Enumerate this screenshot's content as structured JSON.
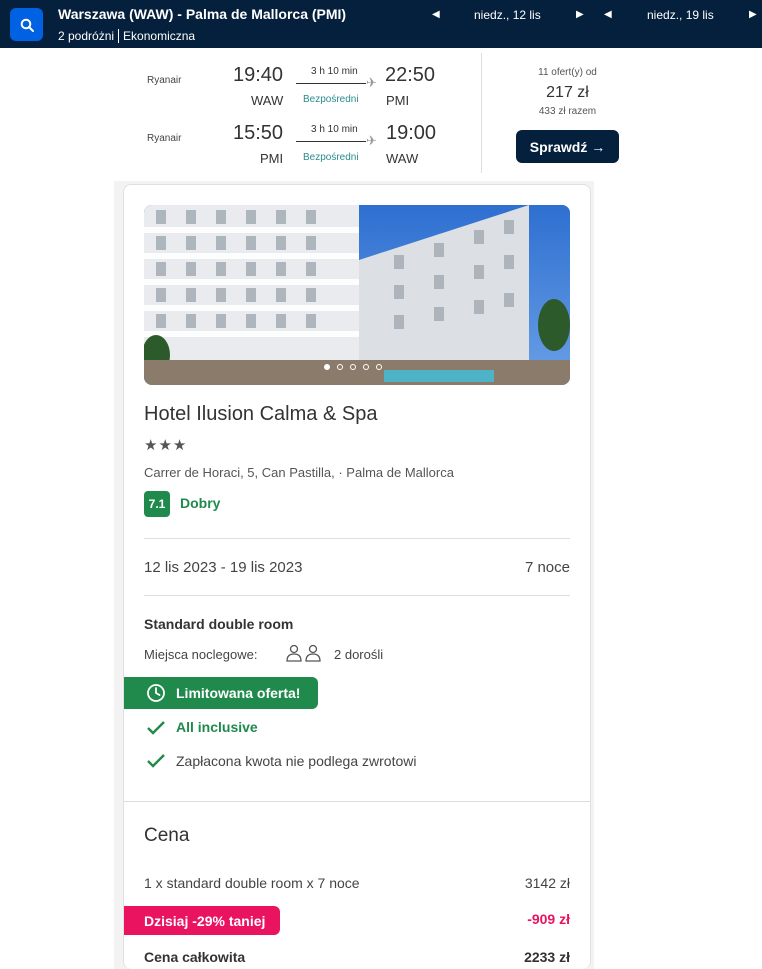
{
  "header": {
    "route": "Warszawa (WAW) - Palma de Mallorca (PMI)",
    "travellers": "2 podróżni",
    "cabin": "Ekonomiczna",
    "depart_date": "niedz., 12 lis",
    "return_date": "niedz., 19 lis"
  },
  "flights": {
    "outbound": {
      "airline": "Ryanair",
      "dep_time": "19:40",
      "dep_code": "WAW",
      "duration": "3 h 10 min",
      "stops": "Bezpośredni",
      "arr_time": "22:50",
      "arr_code": "PMI"
    },
    "inbound": {
      "airline": "Ryanair",
      "dep_time": "15:50",
      "dep_code": "PMI",
      "duration": "3 h 10 min",
      "stops": "Bezpośredni",
      "arr_time": "19:00",
      "arr_code": "WAW"
    },
    "offers_count": "11 ofert(y) od",
    "price": "217 zł",
    "total": "433 zł razem",
    "check_label": "Sprawdź →"
  },
  "hotel": {
    "name": "Hotel Ilusion Calma & Spa",
    "stars": "★★★",
    "address": "Carrer de Horaci, 5, Can Pastilla, · Palma de Mallorca",
    "score": "7.1",
    "score_label": "Dobry",
    "dates": "12 lis 2023 - 19 lis 2023",
    "nights": "7 noce",
    "room": "Standard double room",
    "beds_label": "Miejsca noclegowe:",
    "beds_value": "2 dorośli",
    "limited_offer": "Limitowana oferta!",
    "perks": [
      "All inclusive",
      "Zapłacona kwota nie podlega zwrotowi"
    ],
    "photo_slides": 5,
    "photo_active": 1
  },
  "pricing": {
    "title": "Cena",
    "line_label": "1 x standard double room x 7 noce",
    "line_value": "3142 zł",
    "discount_label": "Dzisiaj -29% taniej",
    "discount_value": "-909 zł",
    "total_label": "Cena całkowita",
    "total_value": "2233 zł"
  },
  "colors": {
    "navy": "#05203c",
    "blue": "#0062e3",
    "green": "#1f8a4c",
    "pink": "#e9135f"
  }
}
